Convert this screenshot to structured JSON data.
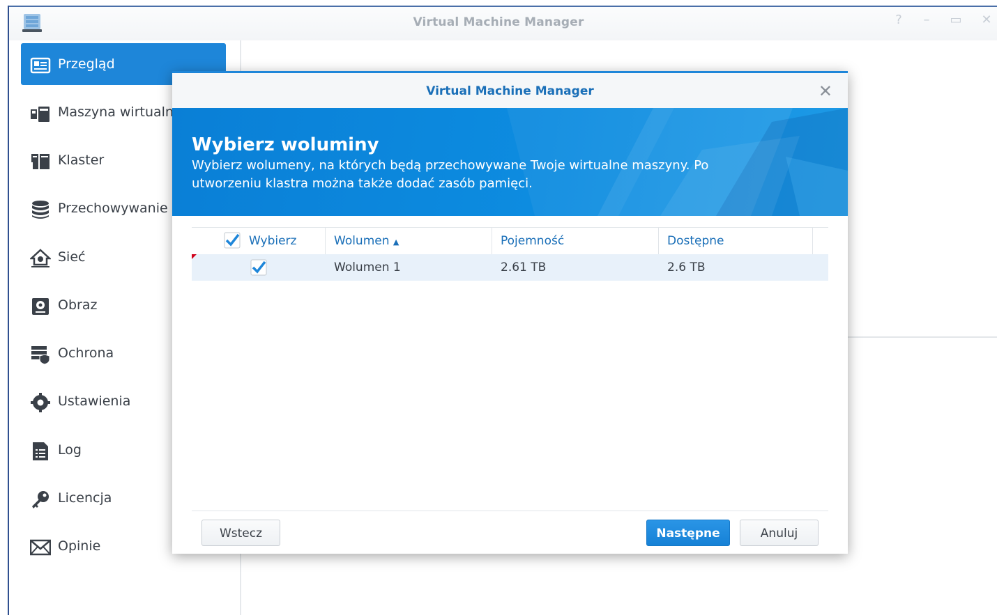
{
  "app": {
    "title": "Virtual Machine Manager",
    "window_controls": [
      "help-icon",
      "minimize-icon",
      "maximize-icon",
      "close-icon"
    ]
  },
  "sidebar": {
    "items": [
      {
        "label": "Przegląd",
        "icon": "overview-icon",
        "active": true
      },
      {
        "label": "Maszyna wirtualna",
        "icon": "virtual-machine-icon",
        "active": false
      },
      {
        "label": "Klaster",
        "icon": "cluster-icon",
        "active": false
      },
      {
        "label": "Przechowywanie",
        "icon": "storage-icon",
        "active": false
      },
      {
        "label": "Sieć",
        "icon": "network-icon",
        "active": false
      },
      {
        "label": "Obraz",
        "icon": "image-icon",
        "active": false
      },
      {
        "label": "Ochrona",
        "icon": "protection-icon",
        "active": false
      },
      {
        "label": "Ustawienia",
        "icon": "settings-icon",
        "active": false
      },
      {
        "label": "Log",
        "icon": "log-icon",
        "active": false
      },
      {
        "label": "Licencja",
        "icon": "license-key-icon",
        "active": false
      },
      {
        "label": "Opinie",
        "icon": "feedback-mail-icon",
        "active": false
      }
    ]
  },
  "dialog": {
    "title": "Virtual Machine Manager",
    "heading": "Wybierz woluminy",
    "description": "Wybierz wolumeny, na których będą przechowywane Twoje wirtualne maszyny. Po utworzeniu klastra można także dodać zasób pamięci.",
    "columns": [
      "Wybierz",
      "Wolumen",
      "Pojemność",
      "Dostępne"
    ],
    "sort_indicator": "▲",
    "rows": [
      {
        "selected": true,
        "volume": "Wolumen 1",
        "capacity": "2.61 TB",
        "available": "2.6 TB"
      }
    ],
    "buttons": {
      "back": "Wstecz",
      "next": "Następne",
      "cancel": "Anuluj"
    }
  },
  "colors": {
    "accent": "#1e86d9",
    "title_blue": "#1a6fb8"
  }
}
